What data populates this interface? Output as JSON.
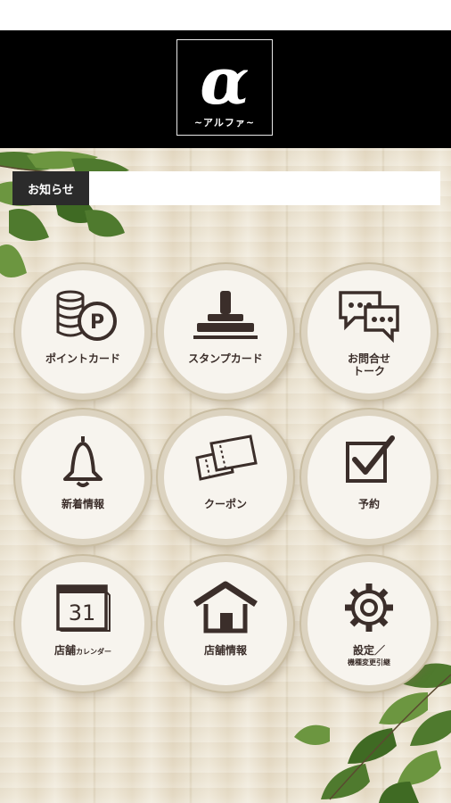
{
  "header": {
    "logo_mark": "α",
    "logo_sub": "~アルファ~"
  },
  "news": {
    "label": "お知らせ"
  },
  "menu": [
    {
      "id": "point-card",
      "label": "ポイントカード",
      "icon": "coins-point-icon"
    },
    {
      "id": "stamp-card",
      "label": "スタンプカード",
      "icon": "stamp-icon"
    },
    {
      "id": "inquiry-talk",
      "label": "お問合せ",
      "label2": "トーク",
      "icon": "chat-bubbles-icon"
    },
    {
      "id": "news-info",
      "label": "新着情報",
      "icon": "bell-icon"
    },
    {
      "id": "coupon",
      "label": "クーポン",
      "icon": "coupon-ticket-icon"
    },
    {
      "id": "reservation",
      "label": "予約",
      "icon": "checkbox-icon"
    },
    {
      "id": "store-calendar",
      "label": "店舗",
      "label_small": "カレンダー",
      "icon": "calendar-icon",
      "calendar_day": "31"
    },
    {
      "id": "store-info",
      "label": "店舗情報",
      "icon": "house-icon"
    },
    {
      "id": "settings",
      "label": "設定／",
      "label_small": "機種変更引継",
      "icon": "gear-icon"
    }
  ],
  "colors": {
    "header_bg": "#000000",
    "news_label_bg": "#2b2b2b",
    "icon_stroke": "#3b2e2a",
    "ring": "#dcd3c0"
  }
}
